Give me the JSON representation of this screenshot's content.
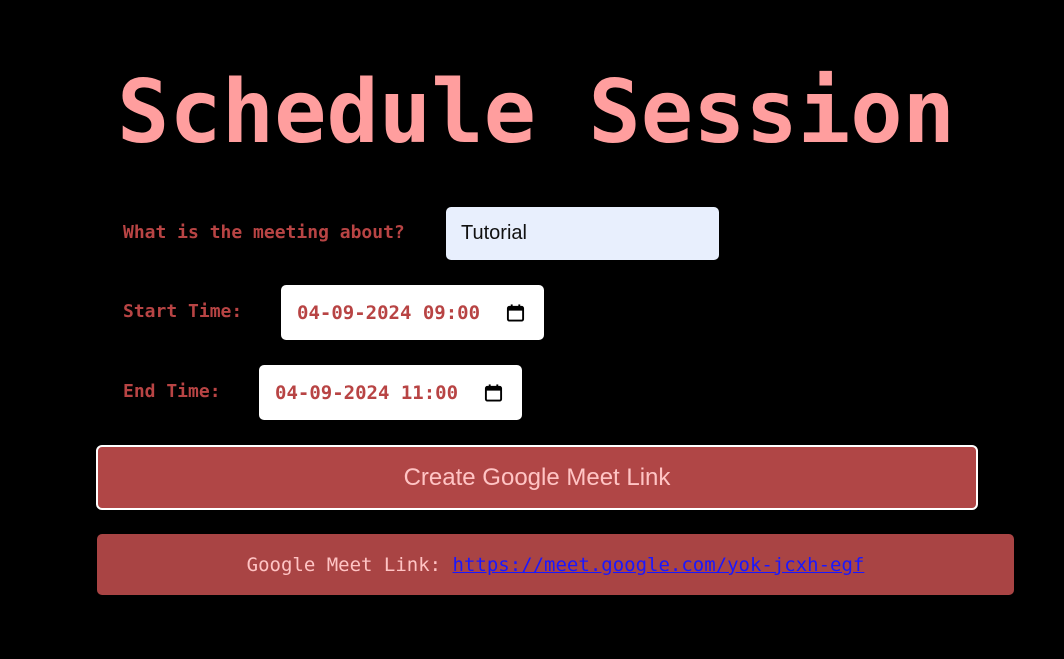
{
  "page": {
    "title": "Schedule Session"
  },
  "form": {
    "topic": {
      "label": "What is the meeting about?",
      "value": "Tutorial"
    },
    "start": {
      "label": "Start Time:",
      "value": "04-09-2024 09:00",
      "icon": "calendar-icon"
    },
    "end": {
      "label": "End Time:",
      "value": "04-09-2024 11:00",
      "icon": "calendar-icon"
    },
    "submit_label": "Create Google Meet Link"
  },
  "result": {
    "label": "Google Meet Link:",
    "link": "https://meet.google.com/yok-jcxh-egf"
  },
  "colors": {
    "background": "#000000",
    "title": "#ff9e9e",
    "label": "#b84444",
    "button": "#b04646",
    "result_box": "#a94444",
    "link": "#1a17ff"
  }
}
